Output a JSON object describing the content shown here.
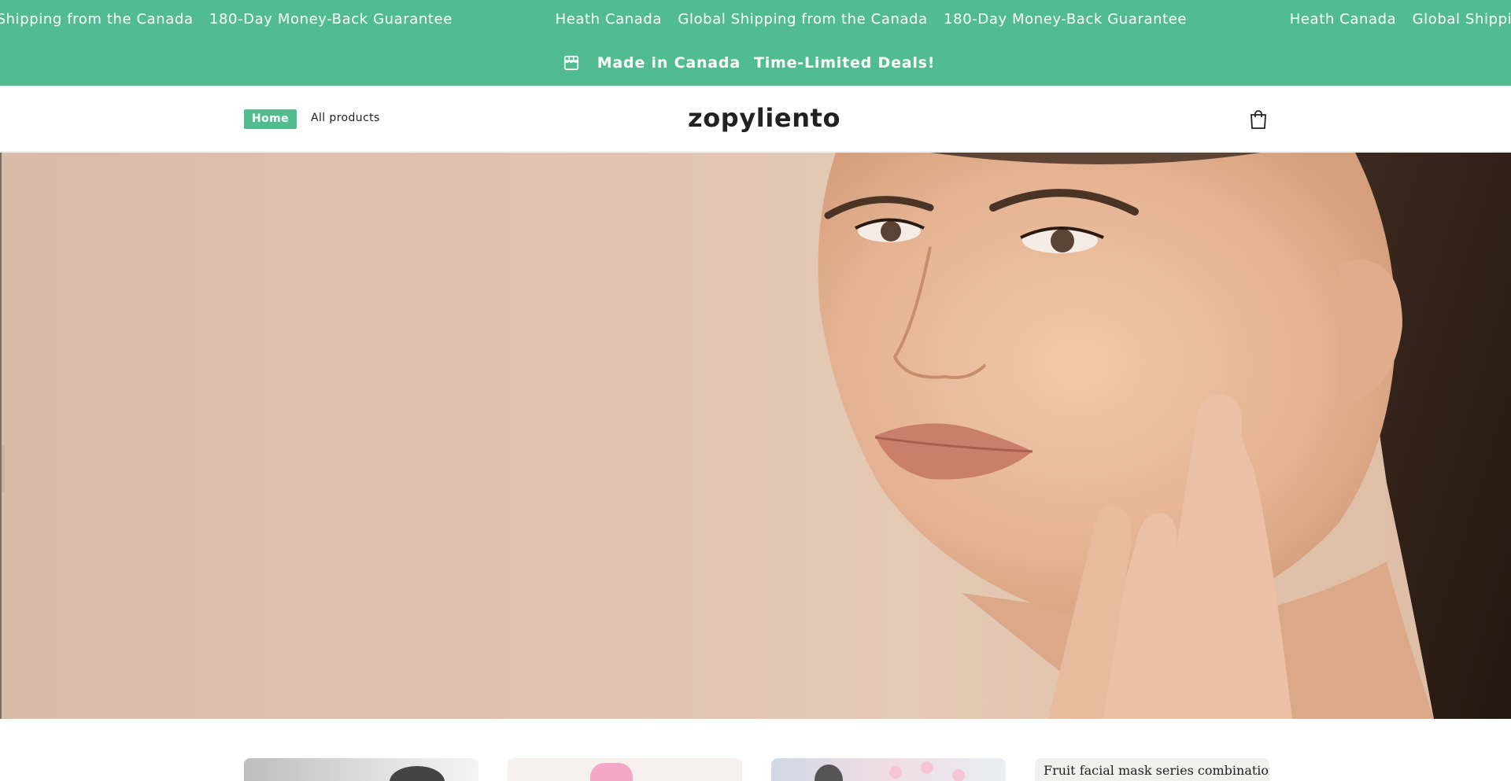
{
  "marquee": {
    "items": [
      "bal Shipping from the Canada",
      "180-Day Money-Back Guarantee",
      "Heath Canada",
      "Global Shipping from the Canada",
      "180-Day Money-Back Guarantee",
      "Heath Canada",
      "Global Shipping from the"
    ]
  },
  "announcement": {
    "icon": "store-icon",
    "primary": "Made in Canada",
    "secondary": "Time-Limited Deals!"
  },
  "header": {
    "nav": [
      {
        "label": "Home",
        "active": true
      },
      {
        "label": "All products",
        "active": false
      }
    ],
    "logo": "zopyliento",
    "cart_icon": "cart-bag-icon"
  },
  "hero": {
    "image": "woman-skincare-portrait"
  },
  "products": {
    "cards": [
      {
        "image": "product-image-1",
        "title": ""
      },
      {
        "image": "product-image-2",
        "title": ""
      },
      {
        "image": "product-image-3",
        "title": ""
      },
      {
        "image": "product-image-4",
        "title": "Fruit facial mask series combination"
      }
    ]
  },
  "colors": {
    "accent": "#50bc90",
    "text": "#222222",
    "background": "#ffffff"
  }
}
